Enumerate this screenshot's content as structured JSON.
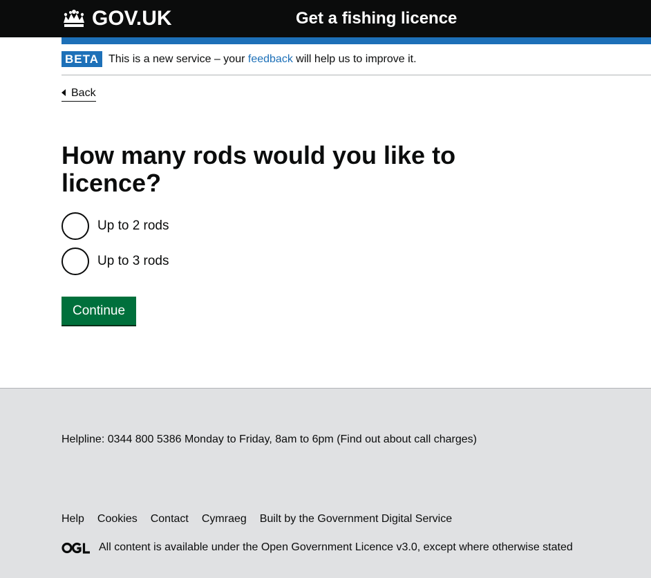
{
  "header": {
    "logo_text": "GOV.UK",
    "service_name": "Get a fishing licence",
    "logo_icon": "crown-icon"
  },
  "phase_banner": {
    "tag": "BETA",
    "text_before": "This is a new service – your",
    "link": "feedback",
    "text_after": "will help us to improve it."
  },
  "back_link": {
    "label": "Back",
    "icon": "back-arrow-icon"
  },
  "question": {
    "heading": "How many rods would you like to licence?",
    "options": [
      {
        "label": "Up to 2 rods",
        "selected": false
      },
      {
        "label": "Up to 3 rods",
        "selected": false
      }
    ]
  },
  "continue_label": "Continue",
  "footer": {
    "helpline_prefix": "Helpline:",
    "phone": "0344 800 5386",
    "hours": "Monday to Friday, 8am to 6pm (",
    "call_charges_link": "Find out about call charges",
    "hours_close": ")",
    "links": [
      "Help",
      "Cookies",
      "Contact",
      "Cymraeg"
    ],
    "built_by_prefix": "Built by the",
    "built_by_link": "Government Digital Service",
    "licence_prefix": "All content is available under the",
    "licence_link": "Open Government Licence v3.0",
    "licence_suffix": ", except where otherwise stated",
    "ogl_icon": "ogl-logo-icon"
  },
  "colors": {
    "header_bg": "#0b0c0c",
    "accent_blue": "#1d70b8",
    "button_green": "#00703c",
    "footer_bg": "#e0e1e3"
  }
}
